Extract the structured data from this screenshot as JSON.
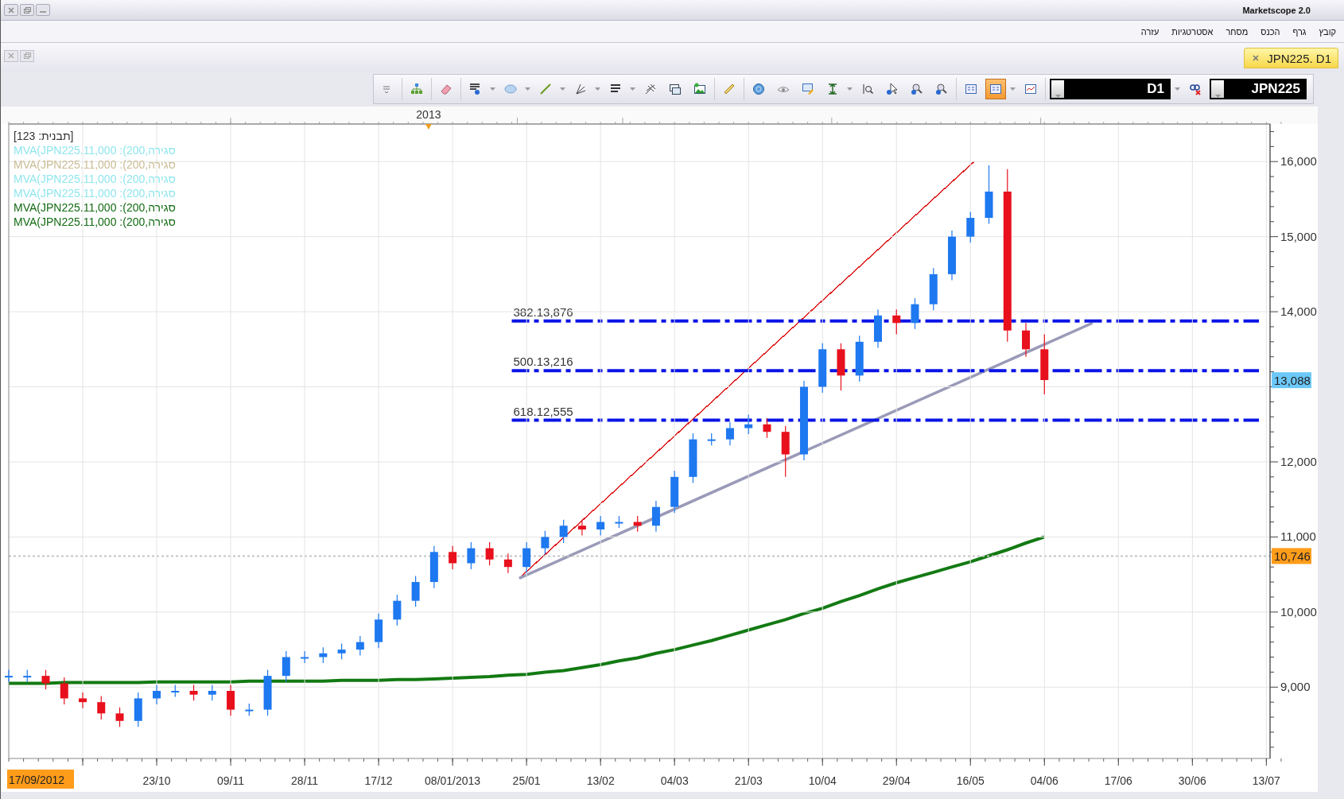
{
  "window": {
    "title": "Marketscope 2.0"
  },
  "menu": [
    {
      "label": "קובץ"
    },
    {
      "label": "גרף"
    },
    {
      "label": "הכנס"
    },
    {
      "label": "מסחר"
    },
    {
      "label": "אסטרטגיות"
    },
    {
      "label": "עזרה"
    }
  ],
  "tab": {
    "label": "JPN225. D1",
    "selected": true
  },
  "toolbar": {
    "view_buttons": [
      {
        "pressed": false
      },
      {
        "pressed": true
      }
    ],
    "timeframe": "D1",
    "instrument": "JPN225"
  },
  "chart": {
    "template_label": "[תבנית: 123]",
    "legend": [
      {
        "text": "MVA(JPN225.11,000 :(200,סגירה",
        "color": "#8fe6ee"
      },
      {
        "text": "MVA(JPN225.11,000 :(200,סגירה",
        "color": "#c9bc94"
      },
      {
        "text": "MVA(JPN225.11,000 :(200,סגירה",
        "color": "#8fe6ee"
      },
      {
        "text": "MVA(JPN225.11,000 :(200,סגירה",
        "color": "#8fe6ee"
      },
      {
        "text": "MVA(JPN225.11,000 :(200,סגירה",
        "color": "#136b13"
      },
      {
        "text": "MVA(JPN225.11,000 :(200,סגירה",
        "color": "#136b13"
      }
    ],
    "year_marker": {
      "label": "2013"
    },
    "cursor_date": {
      "label": "17/09/2012",
      "color": "#ff9c1a"
    },
    "trendlines": [
      {
        "color": "#e02020"
      },
      {
        "color": "#9a9ab8"
      }
    ],
    "moving_average": {
      "color": "#137a13"
    },
    "levels": [
      {
        "label": "382.13,876",
        "color": "#0a14e6"
      },
      {
        "label": "500.13,216",
        "color": "#0a14e6"
      },
      {
        "label": "618.12,555",
        "color": "#0a14e6"
      }
    ],
    "price_badges": [
      {
        "label": "13,088",
        "color": "#6cc8f8"
      },
      {
        "label": "10,746",
        "color": "#ff9c1a"
      }
    ],
    "chart_data": {
      "type": "candlestick",
      "grid": true,
      "categories": [
        null,
        null,
        null,
        null,
        null,
        null,
        null,
        null,
        "23/10",
        null,
        null,
        null,
        "09/11",
        null,
        null,
        null,
        "28/11",
        null,
        null,
        null,
        "17/12",
        null,
        null,
        null,
        "08/01/2013",
        null,
        null,
        null,
        "25/01",
        null,
        null,
        null,
        "13/02",
        null,
        null,
        null,
        "04/03",
        null,
        null,
        null,
        "21/03",
        null,
        null,
        null,
        "10/04",
        null,
        null,
        null,
        "29/04",
        null,
        null,
        null,
        "16/05",
        null,
        null,
        null,
        "04/06",
        null,
        null,
        null,
        "17/06",
        null,
        null,
        null,
        "30/06",
        null,
        null,
        null,
        "13/07"
      ],
      "ohlc": [
        [
          9150,
          9230,
          9070,
          9150
        ],
        [
          9150,
          9230,
          9070,
          9150
        ],
        [
          9150,
          9230,
          8970,
          9050
        ],
        [
          9050,
          9130,
          8770,
          8850
        ],
        [
          8850,
          8930,
          8720,
          8800
        ],
        [
          8800,
          8880,
          8570,
          8650
        ],
        [
          8650,
          8730,
          8470,
          8550
        ],
        [
          8550,
          8930,
          8470,
          8850
        ],
        [
          8850,
          9030,
          8770,
          8950
        ],
        [
          8950,
          9030,
          8870,
          8950
        ],
        [
          8950,
          9030,
          8820,
          8900
        ],
        [
          8900,
          9030,
          8820,
          8950
        ],
        [
          8950,
          9030,
          8620,
          8700
        ],
        [
          8700,
          8780,
          8620,
          8700
        ],
        [
          8700,
          9230,
          8620,
          9150
        ],
        [
          9150,
          9480,
          9070,
          9400
        ],
        [
          9400,
          9480,
          9320,
          9400
        ],
        [
          9400,
          9530,
          9320,
          9450
        ],
        [
          9450,
          9580,
          9370,
          9500
        ],
        [
          9500,
          9680,
          9420,
          9600
        ],
        [
          9600,
          9980,
          9520,
          9900
        ],
        [
          9900,
          10230,
          9820,
          10150
        ],
        [
          10150,
          10480,
          10070,
          10400
        ],
        [
          10400,
          10880,
          10320,
          10800
        ],
        [
          10800,
          10880,
          10570,
          10650
        ],
        [
          10650,
          10930,
          10570,
          10850
        ],
        [
          10850,
          10930,
          10620,
          10700
        ],
        [
          10700,
          10780,
          10520,
          10600
        ],
        [
          10600,
          10930,
          10520,
          10850
        ],
        [
          10850,
          11080,
          10770,
          11000
        ],
        [
          11000,
          11230,
          10920,
          11150
        ],
        [
          11150,
          11230,
          11020,
          11100
        ],
        [
          11100,
          11280,
          11020,
          11200
        ],
        [
          11200,
          11280,
          11120,
          11200
        ],
        [
          11200,
          11280,
          11070,
          11150
        ],
        [
          11150,
          11480,
          11070,
          11400
        ],
        [
          11400,
          11880,
          11320,
          11800
        ],
        [
          11800,
          12380,
          11720,
          12300
        ],
        [
          12300,
          12380,
          12220,
          12300
        ],
        [
          12300,
          12530,
          12220,
          12450
        ],
        [
          12450,
          12630,
          12370,
          12500
        ],
        [
          12500,
          12580,
          12320,
          12400
        ],
        [
          12400,
          12480,
          11800,
          12100
        ],
        [
          12100,
          13080,
          12020,
          13000
        ],
        [
          13000,
          13580,
          12920,
          13500
        ],
        [
          13500,
          13580,
          12950,
          13150
        ],
        [
          13150,
          13680,
          13070,
          13600
        ],
        [
          13600,
          14030,
          13520,
          13950
        ],
        [
          13950,
          14030,
          13700,
          13850
        ],
        [
          13850,
          14180,
          13770,
          14100
        ],
        [
          14100,
          14580,
          14020,
          14500
        ],
        [
          14500,
          15080,
          14420,
          15000
        ],
        [
          15000,
          15330,
          14920,
          15250
        ],
        [
          15250,
          15950,
          15170,
          15600
        ],
        [
          15600,
          15900,
          13600,
          13750
        ],
        [
          13750,
          13850,
          13400,
          13500
        ],
        [
          13500,
          13700,
          12900,
          13090
        ],
        null,
        null,
        null,
        null,
        null,
        null,
        null,
        null,
        null,
        null,
        null,
        null
      ],
      "ylim": [
        8050,
        16500
      ],
      "yticks": [
        {
          "value": 9000,
          "label": "9,000"
        },
        {
          "value": 10000,
          "label": "10,000"
        },
        {
          "value": 11000,
          "label": "11,000"
        },
        {
          "value": 12000,
          "label": "12,000"
        },
        {
          "value": 14000,
          "label": "14,000"
        },
        {
          "value": 15000,
          "label": "15,000"
        },
        {
          "value": 16000,
          "label": "16,000"
        }
      ]
    }
  }
}
